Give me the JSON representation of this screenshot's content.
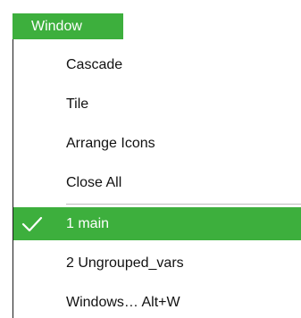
{
  "menubar": {
    "window_label": "Window"
  },
  "menu": {
    "items": [
      {
        "label": "Cascade"
      },
      {
        "label": "Tile"
      },
      {
        "label": "Arrange Icons"
      },
      {
        "label": "Close All"
      },
      {
        "label": "1 main",
        "selected": true,
        "checked": true
      },
      {
        "label": "2 Ungrouped_vars"
      },
      {
        "label": "Windows… Alt+W"
      }
    ]
  },
  "colors": {
    "accent": "#3daf3d",
    "text": "#111111",
    "selected_text": "#ffffff",
    "separator": "#bdbdbd"
  },
  "icons": {
    "checked_item": "check-icon"
  }
}
